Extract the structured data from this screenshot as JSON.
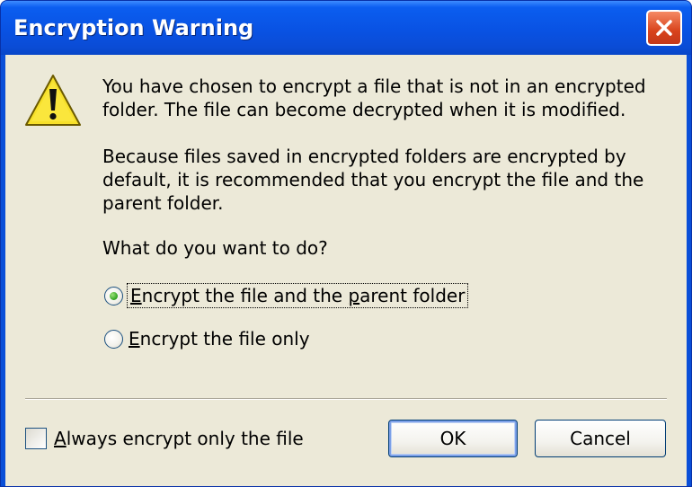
{
  "window": {
    "title": "Encryption Warning",
    "close_icon": "close-icon",
    "warning_icon": "warning-icon"
  },
  "message": {
    "paragraph1": "You have chosen to encrypt a file that is not in an encrypted folder. The file can become decrypted when it is modified.",
    "paragraph2": "Because files saved in encrypted folders are encrypted by default, it is recommended that you encrypt the file and the parent folder.",
    "question": "What do you want to do?"
  },
  "options": {
    "encrypt_file_and_folder": {
      "accel": "E",
      "label_rest": "ncrypt the file and the ",
      "accel2": "p",
      "label_tail": "arent folder",
      "selected": true
    },
    "encrypt_file_only": {
      "accel": "E",
      "label_rest": "ncrypt the file only",
      "selected": false
    }
  },
  "checkbox": {
    "accel": "A",
    "label_rest": "lways encrypt only the file",
    "checked": false
  },
  "buttons": {
    "ok": "OK",
    "cancel": "Cancel"
  },
  "colors": {
    "titlebar": "#0a4fd8",
    "client_bg": "#ece9d8",
    "close_button": "#d8431c",
    "radio_dot": "#2fa31e",
    "warning_yellow": "#f7e02a"
  }
}
